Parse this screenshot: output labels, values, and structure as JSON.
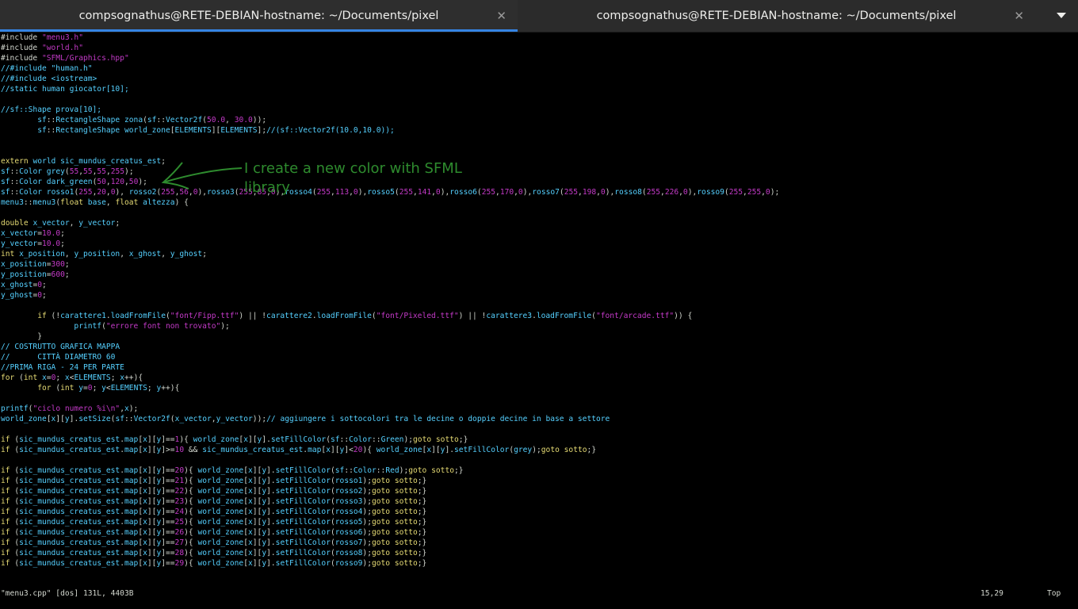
{
  "tabs": [
    {
      "title": "compsognathus@RETE-DEBIAN-hostname: ~/Documents/pixel",
      "active": true
    },
    {
      "title": "compsognathus@RETE-DEBIAN-hostname: ~/Documents/pixel",
      "active": false
    }
  ],
  "annotation": "I create a new color with SFML library",
  "code_lines": [
    "#include \"menu3.h\"",
    "#include \"world.h\"",
    "#include \"SFML/Graphics.hpp\"",
    "//#include \"human.h\"",
    "//#include <iostream>",
    "//static human giocator[10];",
    "",
    "//sf::Shape prova[10];",
    "        sf::RectangleShape zona(sf::Vector2f(50.0, 30.0));",
    "        sf::RectangleShape world_zone[ELEMENTS][ELEMENTS];//(sf::Vector2f(10.0,10.0));",
    "",
    "",
    "extern world sic_mundus_creatus_est;",
    "sf::Color grey(55,55,55,255);",
    "sf::Color dark_green(50,120,50);",
    "sf::Color rosso1(255,20,0), rosso2(255,56,0),rosso3(255,85,0),rosso4(255,113,0),rosso5(255,141,0),rosso6(255,170,0),rosso7(255,198,0),rosso8(255,226,0),rosso9(255,255,0);",
    "menu3::menu3(float base, float altezza) {",
    "",
    "double x_vector, y_vector;",
    "x_vector=10.0;",
    "y_vector=10.0;",
    "int x_position, y_position, x_ghost, y_ghost;",
    "x_position=300;",
    "y_position=600;",
    "x_ghost=0;",
    "y_ghost=0;",
    "",
    "        if (!carattere1.loadFromFile(\"font/Fipp.ttf\") || !carattere2.loadFromFile(\"font/Pixeled.ttf\") || !carattere3.loadFromFile(\"font/arcade.ttf\")) {",
    "                printf(\"errore font non trovato\");",
    "        }",
    "// COSTRUTTO GRAFICA MAPPA",
    "//      CITTÀ DIAMETRO 60",
    "//PRIMA RIGA - 24 PER PARTE",
    "for (int x=0; x<ELEMENTS; x++){",
    "        for (int y=0; y<ELEMENTS; y++){",
    "",
    "printf(\"ciclo numero %i\\n\",x);",
    "world_zone[x][y].setSize(sf::Vector2f(x_vector,y_vector));// aggiungere i sottocolori tra le decine o doppie decine in base a settore",
    "",
    "if (sic_mundus_creatus_est.map[x][y]==1){ world_zone[x][y].setFillColor(sf::Color::Green);goto sotto;}",
    "if (sic_mundus_creatus_est.map[x][y]>=10 && sic_mundus_creatus_est.map[x][y]<20){ world_zone[x][y].setFillColor(grey);goto sotto;}",
    "",
    "if (sic_mundus_creatus_est.map[x][y]==20){ world_zone[x][y].setFillColor(sf::Color::Red);goto sotto;}",
    "if (sic_mundus_creatus_est.map[x][y]==21){ world_zone[x][y].setFillColor(rosso1);goto sotto;}",
    "if (sic_mundus_creatus_est.map[x][y]==22){ world_zone[x][y].setFillColor(rosso2);goto sotto;}",
    "if (sic_mundus_creatus_est.map[x][y]==23){ world_zone[x][y].setFillColor(rosso3);goto sotto;}",
    "if (sic_mundus_creatus_est.map[x][y]==24){ world_zone[x][y].setFillColor(rosso4);goto sotto;}",
    "if (sic_mundus_creatus_est.map[x][y]==25){ world_zone[x][y].setFillColor(rosso5);goto sotto;}",
    "if (sic_mundus_creatus_est.map[x][y]==26){ world_zone[x][y].setFillColor(rosso6);goto sotto;}",
    "if (sic_mundus_creatus_est.map[x][y]==27){ world_zone[x][y].setFillColor(rosso7);goto sotto;}",
    "if (sic_mundus_creatus_est.map[x][y]==28){ world_zone[x][y].setFillColor(rosso8);goto sotto;}",
    "if (sic_mundus_creatus_est.map[x][y]==29){ world_zone[x][y].setFillColor(rosso9);goto sotto;}"
  ],
  "status": {
    "file_info": "\"menu3.cpp\" [dos] 131L, 4403B",
    "position": "15,29",
    "scroll": "Top"
  },
  "colors": {
    "keyword": "#e6db74",
    "comment": "#55d0ff",
    "string": "#c43ac8",
    "text": "#d3d7cf",
    "annotation": "#2e8b2e",
    "tab_accent": "#3584e4"
  },
  "icons": [
    "close-icon",
    "tab-menu-icon"
  ]
}
